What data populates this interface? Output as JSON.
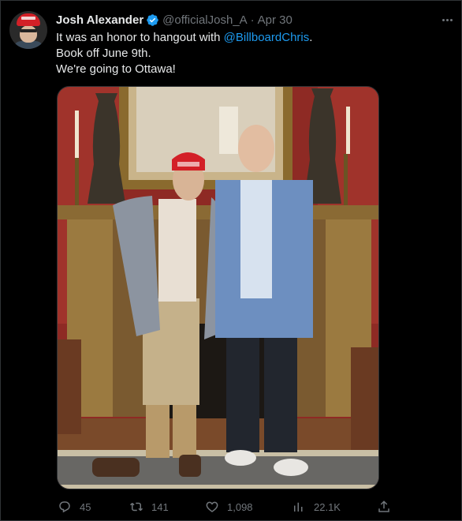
{
  "tweet": {
    "author_name": "Josh Alexander",
    "author_handle": "@officialJosh_A",
    "separator": "·",
    "date": "Apr 30",
    "text": {
      "line1_prefix": "It was an honor to hangout with ",
      "line1_mention": "@BillboardChris",
      "line1_suffix": ".",
      "line2": "Book off June 9th.",
      "line3": "We're going to Ottawa!"
    },
    "photo": {
      "cap_text_line1": "SAVE",
      "cap_text_line2": "CANADA"
    },
    "actions": {
      "replies": "45",
      "retweets": "141",
      "likes": "1,098",
      "views": "22.1K"
    }
  },
  "colors": {
    "background": "#000000",
    "text": "#e7e9ea",
    "muted": "#71767b",
    "link": "#1d9bf0",
    "verified": "#1d9bf0",
    "border": "#2f3336"
  },
  "icons": {
    "verified": "verified-badge-icon",
    "more": "more-options-icon",
    "reply": "reply-icon",
    "retweet": "retweet-icon",
    "like": "heart-icon",
    "views": "views-icon",
    "share": "share-icon"
  }
}
